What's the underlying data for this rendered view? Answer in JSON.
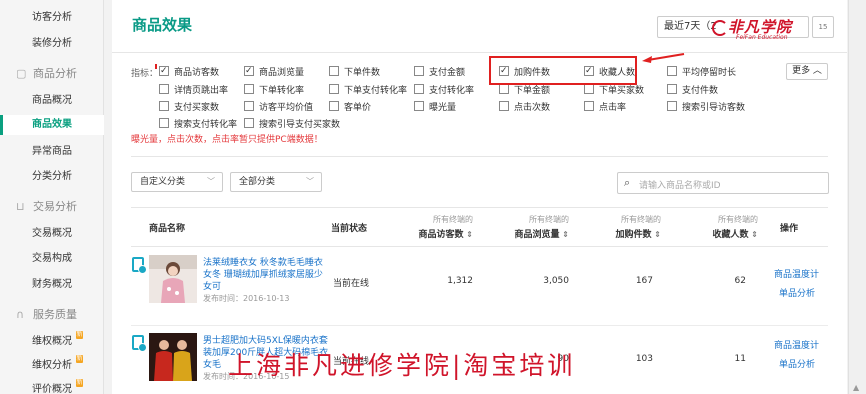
{
  "sidebar": {
    "items": [
      {
        "label": "访客分析"
      },
      {
        "label": "装修分析"
      },
      {
        "label": "商品概况"
      },
      {
        "label": "商品效果"
      },
      {
        "label": "异常商品"
      },
      {
        "label": "分类分析"
      },
      {
        "label": "交易概况"
      },
      {
        "label": "交易构成"
      },
      {
        "label": "财务概况"
      },
      {
        "label": "维权概况"
      },
      {
        "label": "维权分析"
      },
      {
        "label": "评价概况"
      }
    ],
    "groups": [
      {
        "label": "商品分析",
        "icon": "box-icon"
      },
      {
        "label": "交易分析",
        "icon": "cart-icon"
      },
      {
        "label": "服务质量",
        "icon": "headset-icon"
      }
    ],
    "badge_text": "新"
  },
  "main": {
    "title": "商品效果",
    "date_range": "最近7天（2",
    "calendar_day": "15",
    "metrics_label": "指标：",
    "more_label": "更多 ︿",
    "hint": "曝光量，点击次数，点击率暂只提供PC端数据！",
    "metrics": [
      {
        "label": "商品访客数",
        "checked": true
      },
      {
        "label": "商品浏览量",
        "checked": true
      },
      {
        "label": "下单件数",
        "checked": false
      },
      {
        "label": "支付金额",
        "checked": false
      },
      {
        "label": "加购件数",
        "checked": true
      },
      {
        "label": "收藏人数",
        "checked": true
      },
      {
        "label": "平均停留时长",
        "checked": false
      },
      {
        "label": "详情页跳出率",
        "checked": false
      },
      {
        "label": "下单转化率",
        "checked": false
      },
      {
        "label": "下单支付转化率",
        "checked": false
      },
      {
        "label": "支付转化率",
        "checked": false
      },
      {
        "label": "下单金额",
        "checked": false
      },
      {
        "label": "下单买家数",
        "checked": false
      },
      {
        "label": "支付件数",
        "checked": false
      },
      {
        "label": "支付买家数",
        "checked": false
      },
      {
        "label": "访客平均价值",
        "checked": false
      },
      {
        "label": "客单价",
        "checked": false
      },
      {
        "label": "曝光量",
        "checked": false
      },
      {
        "label": "点击次数",
        "checked": false
      },
      {
        "label": "点击率",
        "checked": false
      },
      {
        "label": "搜索引导访客数",
        "checked": false
      },
      {
        "label": "搜索支付转化率",
        "checked": false
      },
      {
        "label": "搜索引导支付买家数",
        "checked": false
      }
    ],
    "filters": {
      "custom_category": "自定义分类",
      "all_category": "全部分类",
      "search_placeholder": "请输入商品名称或ID"
    }
  },
  "table": {
    "headers": {
      "name": "商品名称",
      "status": "当前状态",
      "sub_label": "所有终端的",
      "visitors": "商品访客数",
      "views": "商品浏览量",
      "cart": "加购件数",
      "fav": "收藏人数",
      "action": "操作"
    },
    "rows": [
      {
        "name": "法莱绒睡衣女 秋冬款毛毛睡衣女冬 珊瑚绒加厚抓绒家居服少女可",
        "date": "发布时间：2016-10-13",
        "status": "当前在线",
        "visitors": "1,312",
        "views": "3,050",
        "cart": "167",
        "fav": "62",
        "action1": "商品温度计",
        "action2": "单品分析"
      },
      {
        "name": "男士超肥加大码5XL保暖内衣套装加厚200斤胖人超大码棉毛衣女毛",
        "date": "发布时间：2016-10-15",
        "status": "当前在线",
        "visitors": "",
        "views": "90",
        "cart": "103",
        "fav": "11",
        "action1": "商品温度计",
        "action2": "单品分析"
      }
    ]
  },
  "logo": {
    "main": "非凡学院",
    "sub": "FeiFan Education"
  },
  "watermark": "上海非凡进修学院|淘宝培训",
  "colors": {
    "accent": "#0aa080",
    "link": "#1a73c9",
    "highlight": "#e02020"
  }
}
